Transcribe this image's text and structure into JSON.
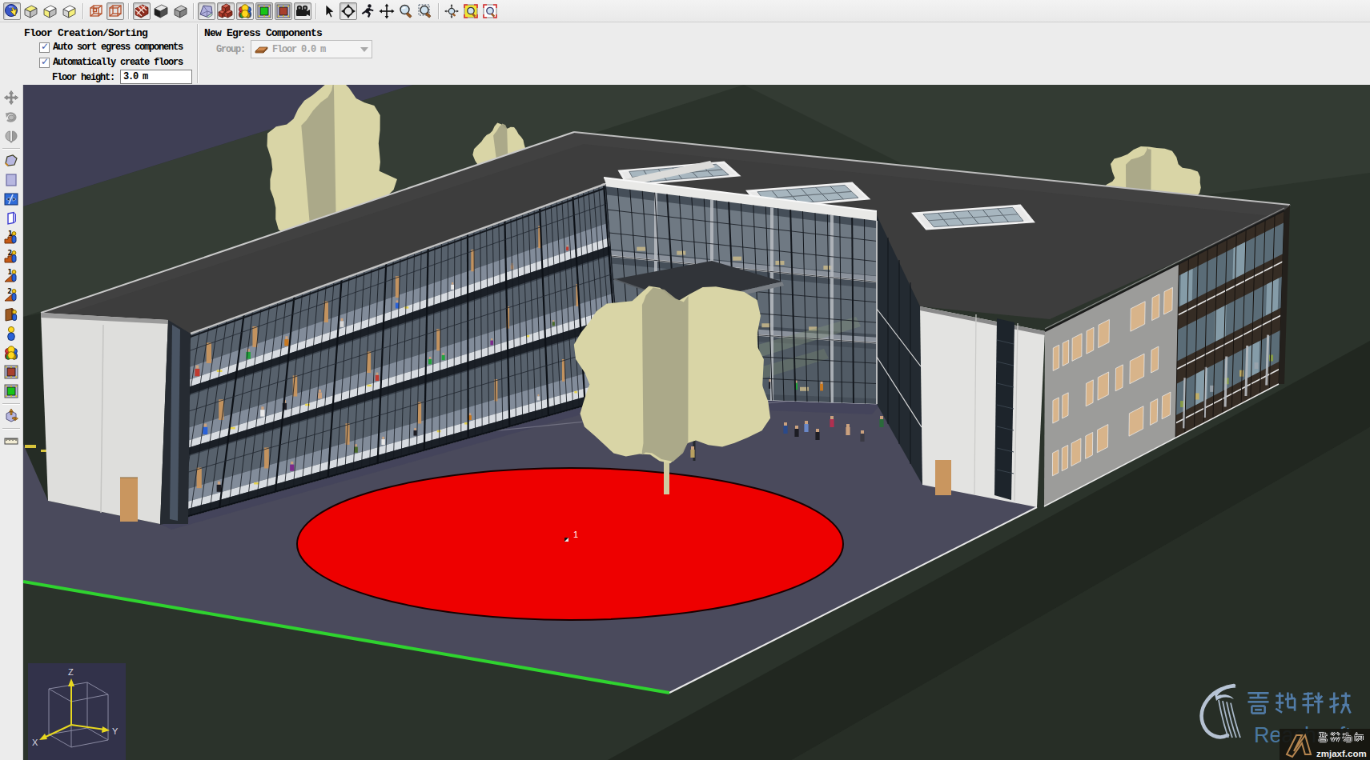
{
  "toolbar_main": {
    "groups": [
      {
        "buttons": [
          {
            "name": "select-object",
            "icon": "select-sphere",
            "pressed": true
          },
          {
            "name": "view-top",
            "icon": "cube-top"
          },
          {
            "name": "view-front",
            "icon": "cube-front"
          },
          {
            "name": "view-side",
            "icon": "cube-side"
          }
        ]
      },
      {
        "buttons": [
          {
            "name": "wireframe-all",
            "icon": "wire-cube-inner"
          },
          {
            "name": "wireframe",
            "icon": "wire-cube",
            "pressed": true
          }
        ]
      },
      {
        "buttons": [
          {
            "name": "show-hatched-solids",
            "icon": "cube-hatch",
            "pressed": true
          },
          {
            "name": "show-dark-solids",
            "icon": "cube-dark"
          },
          {
            "name": "show-gray-solids",
            "icon": "cube-gray"
          }
        ]
      },
      {
        "buttons": [
          {
            "name": "show-terrain",
            "icon": "terrain",
            "pressed": true
          },
          {
            "name": "show-objects",
            "icon": "red-cubes",
            "pressed": true
          },
          {
            "name": "show-occupants",
            "icon": "people",
            "pressed": true
          },
          {
            "name": "show-entries",
            "icon": "monitor-green",
            "pressed": true
          },
          {
            "name": "show-exits",
            "icon": "monitor-red",
            "pressed": true
          },
          {
            "name": "show-cameras",
            "icon": "camera",
            "pressed": true
          }
        ]
      },
      {
        "buttons": [
          {
            "name": "pointer-tool",
            "icon": "cursor"
          },
          {
            "name": "orbit-tool",
            "icon": "orbit",
            "pressed": true
          },
          {
            "name": "walk-tool",
            "icon": "runner"
          },
          {
            "name": "pan-tool",
            "icon": "pan"
          },
          {
            "name": "zoom-tool",
            "icon": "zoom"
          },
          {
            "name": "zoom-box-tool",
            "icon": "zoom-box"
          }
        ]
      },
      {
        "buttons": [
          {
            "name": "zoom-point-tool",
            "icon": "zoom-point"
          },
          {
            "name": "zoom-selected-tool",
            "icon": "zoom-yellow"
          },
          {
            "name": "zoom-fit-tool",
            "icon": "zoom-fit"
          }
        ]
      }
    ]
  },
  "toolbar_left": {
    "groups": [
      {
        "buttons": [
          {
            "name": "move-tool",
            "icon": "move-gray",
            "disabled": true
          },
          {
            "name": "rotate-tool",
            "icon": "rotate-gray",
            "disabled": true
          },
          {
            "name": "mirror-tool",
            "icon": "mirror-gray",
            "disabled": true
          }
        ]
      },
      {
        "buttons": [
          {
            "name": "polygon-room-tool",
            "icon": "poly-room"
          },
          {
            "name": "rectangle-room-tool",
            "icon": "rect-room"
          },
          {
            "name": "thin-wall-tool",
            "icon": "thin-wall"
          },
          {
            "name": "door-tool",
            "icon": "door"
          },
          {
            "name": "stairs-one-way-tool",
            "icon": "stairs1"
          },
          {
            "name": "stairs-two-way-tool",
            "icon": "stairs2"
          },
          {
            "name": "ramp-one-way-tool",
            "icon": "ramp1"
          },
          {
            "name": "ramp-two-way-tool",
            "icon": "ramp2"
          },
          {
            "name": "elevator-tool",
            "icon": "elevator"
          },
          {
            "name": "add-occupant-tool",
            "icon": "person"
          },
          {
            "name": "add-group-tool",
            "icon": "people"
          },
          {
            "name": "exit-tool",
            "icon": "monitor-red"
          },
          {
            "name": "entry-tool",
            "icon": "monitor-green"
          }
        ]
      },
      {
        "buttons": [
          {
            "name": "solid-geometry-tool",
            "icon": "solid-arrows"
          }
        ]
      },
      {
        "buttons": [
          {
            "name": "measure-tool",
            "icon": "ruler"
          }
        ]
      }
    ]
  },
  "panels": {
    "floor_creation": {
      "title": "Floor Creation/Sorting",
      "checkboxes": [
        {
          "label": "Auto sort egress components",
          "checked": true
        },
        {
          "label": "Automatically create floors",
          "checked": true
        }
      ],
      "floor_height_label": "Floor height:",
      "floor_height_value": "3.0 m"
    },
    "new_egress": {
      "title": "New Egress Components",
      "group_label": "Group:",
      "group_value": "Floor 0.0 m",
      "disabled": true
    }
  },
  "viewport": {
    "axis_gizmo": {
      "z": "Z",
      "x": "X",
      "y": "Y"
    },
    "marker_label": "1",
    "watermark": {
      "brand_cjk": "睿驰科技",
      "brand_latin": "Reachsoft",
      "badge_cjk": "智淼消防",
      "badge_domain": "zmjaxf.com"
    },
    "colors": {
      "sky": "#3f3f55",
      "ground": "#2b332b",
      "ground_light": "#39413a",
      "ground_dark": "#20261e",
      "plaza": "#4a4a5c",
      "red_zone": "#ee0000",
      "green_line": "#2fd32f",
      "tree_light": "#d9d5a6",
      "tree_shadow": "#a9a687",
      "roof": "#3d3d3d",
      "roof_trim": "#c9c9c9",
      "wall_white": "#dededc",
      "glass_dark": "#242a33",
      "glass_mid": "#5c6670",
      "walkway": "#7a8494",
      "slab": "#e8e8e8",
      "door_tan": "#c9965f",
      "window_tan": "#d8b48a",
      "wall_gray": "#9c9c9a",
      "watermark_blue": "#527ca8",
      "badge_bronze": "#b5854f"
    }
  }
}
